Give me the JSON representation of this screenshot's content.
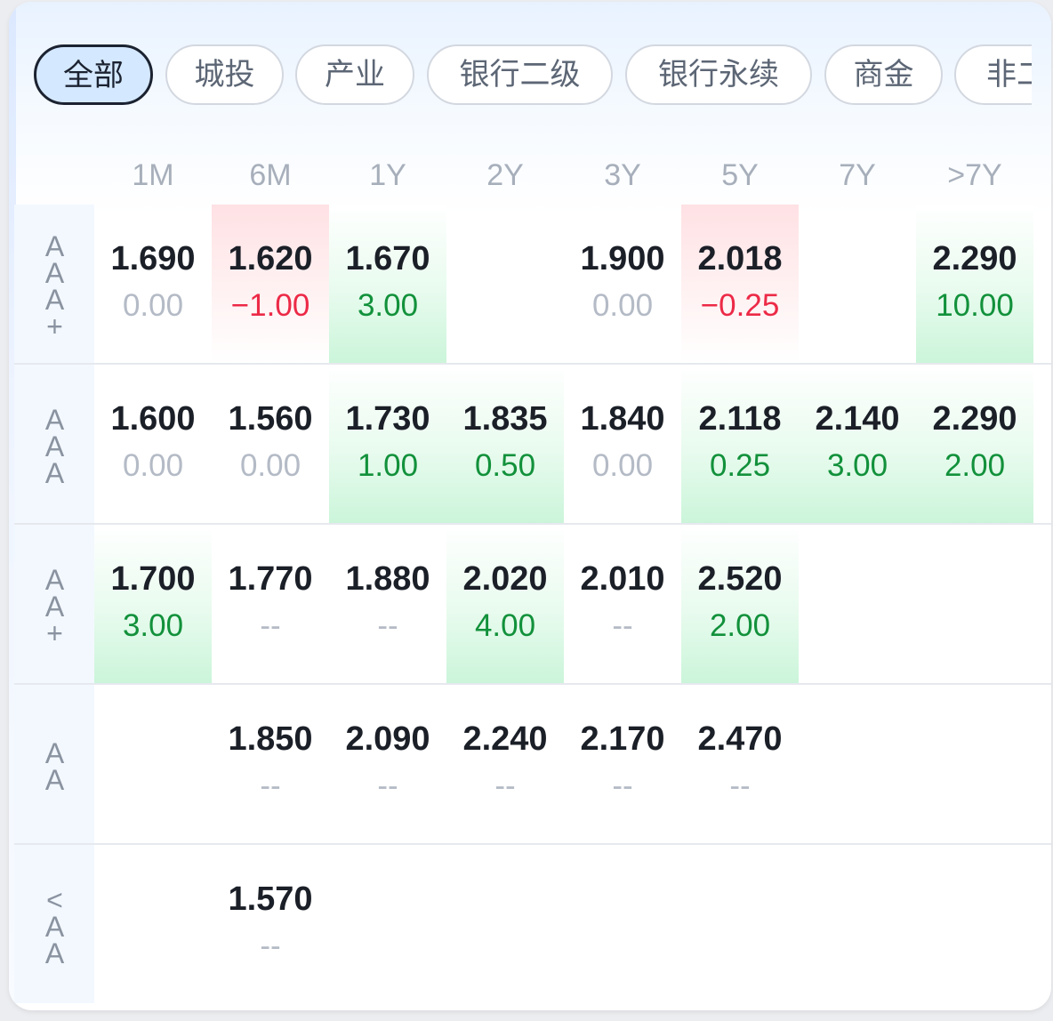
{
  "filters": [
    "全部",
    "城投",
    "产业",
    "银行二级",
    "银行永续",
    "商金",
    "非二"
  ],
  "active_filter": 0,
  "tenors": [
    "1M",
    "6M",
    "1Y",
    "2Y",
    "3Y",
    "5Y",
    "7Y",
    ">7Y"
  ],
  "rows": [
    {
      "rating": "AAA+",
      "cells": [
        {
          "value": "1.690",
          "change": "0.00",
          "trend": "flat"
        },
        {
          "value": "1.620",
          "change": "−1.00",
          "trend": "down"
        },
        {
          "value": "1.670",
          "change": "3.00",
          "trend": "up"
        },
        null,
        {
          "value": "1.900",
          "change": "0.00",
          "trend": "flat"
        },
        {
          "value": "2.018",
          "change": "−0.25",
          "trend": "down"
        },
        null,
        {
          "value": "2.290",
          "change": "10.00",
          "trend": "up"
        }
      ]
    },
    {
      "rating": "AAA",
      "cells": [
        {
          "value": "1.600",
          "change": "0.00",
          "trend": "flat"
        },
        {
          "value": "1.560",
          "change": "0.00",
          "trend": "flat"
        },
        {
          "value": "1.730",
          "change": "1.00",
          "trend": "up"
        },
        {
          "value": "1.835",
          "change": "0.50",
          "trend": "up"
        },
        {
          "value": "1.840",
          "change": "0.00",
          "trend": "flat"
        },
        {
          "value": "2.118",
          "change": "0.25",
          "trend": "up"
        },
        {
          "value": "2.140",
          "change": "3.00",
          "trend": "up"
        },
        {
          "value": "2.290",
          "change": "2.00",
          "trend": "up"
        }
      ]
    },
    {
      "rating": "AA+",
      "cells": [
        {
          "value": "1.700",
          "change": "3.00",
          "trend": "up"
        },
        {
          "value": "1.770",
          "change": "--",
          "trend": "none"
        },
        {
          "value": "1.880",
          "change": "--",
          "trend": "none"
        },
        {
          "value": "2.020",
          "change": "4.00",
          "trend": "up"
        },
        {
          "value": "2.010",
          "change": "--",
          "trend": "none"
        },
        {
          "value": "2.520",
          "change": "2.00",
          "trend": "up"
        },
        null,
        null
      ]
    },
    {
      "rating": "AA",
      "cells": [
        null,
        {
          "value": "1.850",
          "change": "--",
          "trend": "none"
        },
        {
          "value": "2.090",
          "change": "--",
          "trend": "none"
        },
        {
          "value": "2.240",
          "change": "--",
          "trend": "none"
        },
        {
          "value": "2.170",
          "change": "--",
          "trend": "none"
        },
        {
          "value": "2.470",
          "change": "--",
          "trend": "none"
        },
        null,
        null
      ]
    },
    {
      "rating": "<AA",
      "cells": [
        null,
        {
          "value": "1.570",
          "change": "--",
          "trend": "none"
        },
        null,
        null,
        null,
        null,
        null,
        null
      ]
    }
  ],
  "colors": {
    "up_text": "#12913b",
    "down_text": "#ec2a47",
    "flat_text": "#b4bbc6",
    "active_chip_bg": "#d4e8ff"
  }
}
